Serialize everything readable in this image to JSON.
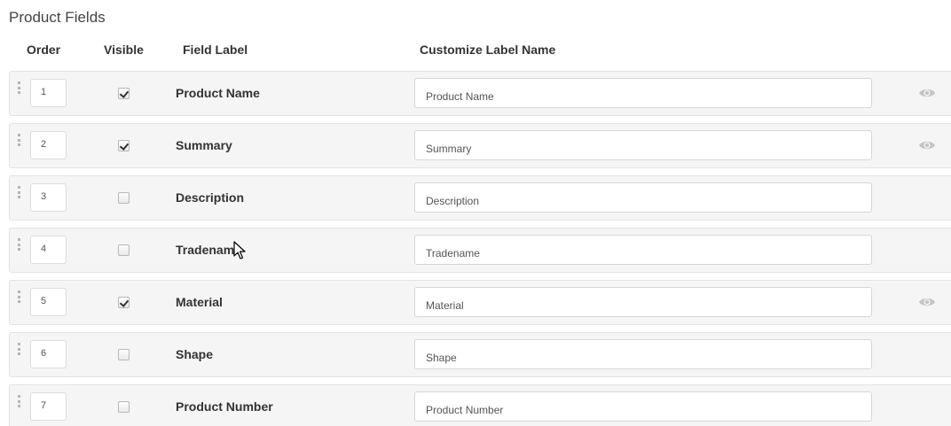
{
  "section": {
    "title": "Product Fields"
  },
  "columns": {
    "order": "Order",
    "visible": "Visible",
    "field_label": "Field Label",
    "customize": "Customize Label Name"
  },
  "rows": [
    {
      "order": "1",
      "visible": true,
      "label": "Product Name",
      "custom": "Product Name",
      "eye": true
    },
    {
      "order": "2",
      "visible": true,
      "label": "Summary",
      "custom": "Summary",
      "eye": true
    },
    {
      "order": "3",
      "visible": false,
      "label": "Description",
      "custom": "Description",
      "eye": false
    },
    {
      "order": "4",
      "visible": false,
      "label": "Tradename",
      "custom": "Tradename",
      "eye": false
    },
    {
      "order": "5",
      "visible": true,
      "label": "Material",
      "custom": "Material",
      "eye": true
    },
    {
      "order": "6",
      "visible": false,
      "label": "Shape",
      "custom": "Shape",
      "eye": false
    },
    {
      "order": "7",
      "visible": false,
      "label": "Product Number",
      "custom": "Product Number",
      "eye": false
    }
  ],
  "icons": {
    "drag": "drag-handle-icon",
    "eye": "eye-icon",
    "cursor": "mouse-pointer-icon"
  },
  "colors": {
    "row_background": "#f5f5f5",
    "row_border": "#e3e3e3",
    "eye": "#c4c4c4",
    "text": "#333333"
  }
}
